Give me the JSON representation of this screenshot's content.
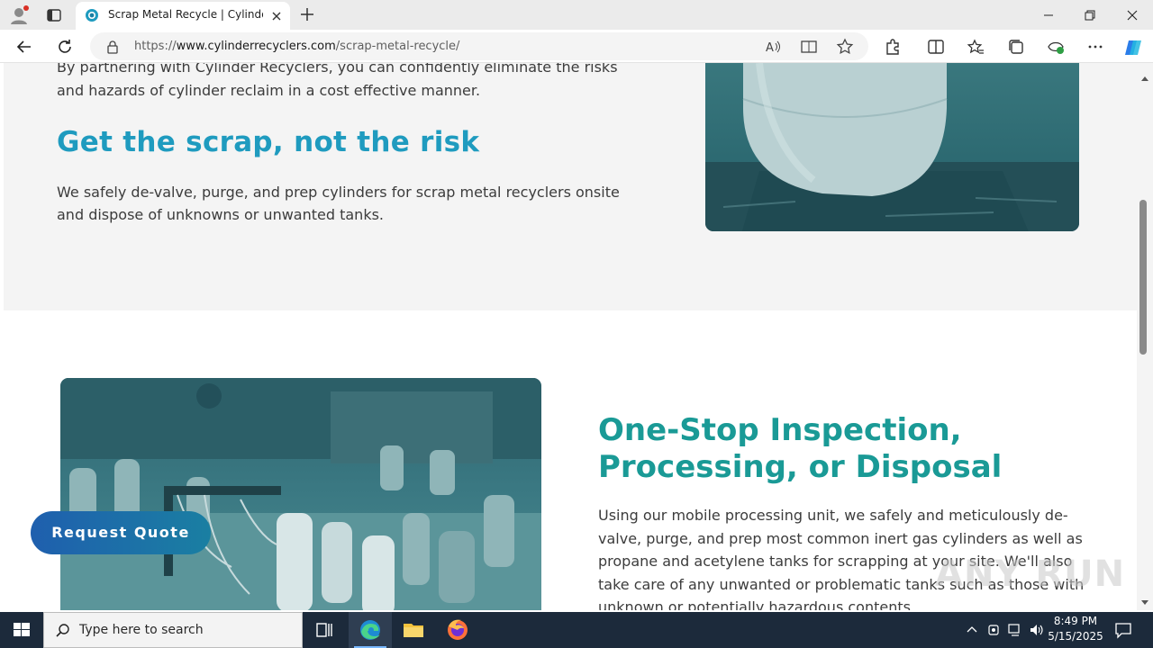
{
  "browser": {
    "tab": {
      "title": "Scrap Metal Recycle | Cylinder Pr"
    },
    "address": {
      "prefix": "https://",
      "host": "www.cylinderrecyclers.com",
      "path": "/scrap-metal-recycle/"
    }
  },
  "page": {
    "intro_text": "By partnering with Cylinder Recyclers, you can confidently eliminate the risks and hazards of cylinder reclaim in a cost effective manner.",
    "scrap_heading": "Get the scrap, not the risk",
    "scrap_text": "We safely de-valve, purge, and prep cylinders for scrap metal recyclers onsite and dispose of unknowns or unwanted tanks.",
    "onestop_heading": "One-Stop Inspection, Processing, or Disposal",
    "onestop_text": "Using our mobile processing unit, we safely and meticulously de-valve, purge, and prep most common inert gas cylinders as well as propane and acetylene tanks for scrapping at your site. We'll also take care of any unwanted or problematic tanks such as those with unknown or potentially hazardous contents.",
    "quote_button": "Request Quote"
  },
  "watermark": "ANY RUN",
  "taskbar": {
    "search_placeholder": "Type here to search",
    "time": "8:49 PM",
    "date": "5/15/2025"
  },
  "colors": {
    "heading_blue": "#1f9bbf",
    "heading_teal": "#1a9a96",
    "button_gradient_start": "#1f5fae",
    "button_gradient_end": "#1a7fa2",
    "taskbar": "#1c2a3b"
  },
  "icons": [
    "profile-icon",
    "tab-actions-icon",
    "site-favicon",
    "close-icon",
    "plus-icon",
    "minimize-icon",
    "maximize-icon",
    "back-icon",
    "refresh-icon",
    "lock-icon",
    "read-aloud-icon",
    "immersive-reader-icon",
    "favorite-star-icon",
    "extensions-icon",
    "split-screen-icon",
    "favorites-icon",
    "collections-icon",
    "performance-icon",
    "more-icon",
    "copilot-icon",
    "windows-start-icon",
    "search-icon",
    "task-view-icon",
    "edge-icon",
    "file-explorer-icon",
    "firefox-icon",
    "chevron-up-icon",
    "network-icon",
    "volume-icon",
    "notification-icon"
  ]
}
